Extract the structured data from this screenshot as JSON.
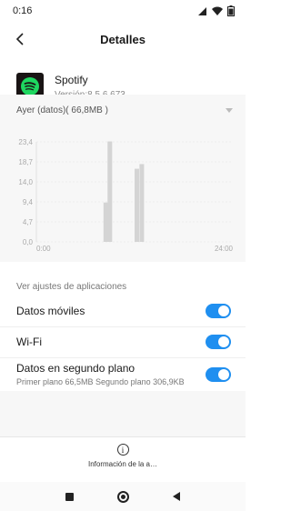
{
  "status_bar": {
    "time": "0:16",
    "battery_level": "75"
  },
  "header": {
    "title": "Detalles"
  },
  "app": {
    "name": "Spotify",
    "version": "Versión:8.5.6.673",
    "icon": "spotify-icon",
    "icon_color": "#1ED760"
  },
  "date_selector": {
    "value": "Ayer (datos)( 66,8MB )"
  },
  "chart_data": {
    "type": "bar",
    "y_ticks": [
      "23,4",
      "18,7",
      "14,0",
      "9,4",
      "4,7",
      "0,0"
    ],
    "x_ticks": [
      "0:00",
      "24:00"
    ],
    "ylim": [
      0,
      23.4
    ],
    "bar_color": "#d4d4d4",
    "bars": [
      {
        "hour": 8.2,
        "value": 9.2
      },
      {
        "hour": 8.7,
        "value": 23.5
      },
      {
        "hour": 12.0,
        "value": 17.1
      },
      {
        "hour": 12.6,
        "value": 18.2
      }
    ]
  },
  "settings": {
    "section_title": "Ver ajustes de aplicaciones",
    "mobile_data": {
      "label": "Datos móviles",
      "enabled": true
    },
    "wifi": {
      "label": "Wi-Fi",
      "enabled": true
    },
    "background_data": {
      "label": "Datos en segundo plano",
      "detail": "Primer plano 66,5MB  Segundo plano 306,9KB",
      "enabled": true
    }
  },
  "footer": {
    "info_label": "Información de la a…"
  },
  "accent_color": "#1F8FF0"
}
